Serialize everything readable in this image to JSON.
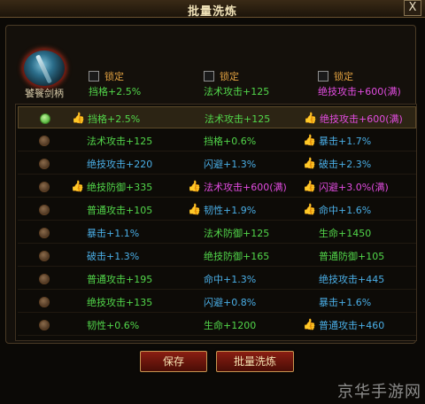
{
  "window": {
    "title": "批量洗炼",
    "close": "X"
  },
  "item": {
    "name": "饕餮剑柄",
    "icon": "sword-hilt-icon"
  },
  "lock_label": "锁定",
  "locks": [
    {
      "value": "挡格+2.5%",
      "color": "#52d64a"
    },
    {
      "value": "法术攻击+125",
      "color": "#52d64a"
    },
    {
      "value": "绝技攻击+600(满)",
      "color": "#e24ce0"
    }
  ],
  "rows": [
    {
      "selected": true,
      "cells": [
        {
          "text": "挡格+2.5%",
          "color": "green",
          "thumb": true
        },
        {
          "text": "法术攻击+125",
          "color": "green",
          "thumb": false
        },
        {
          "text": "绝技攻击+600(满)",
          "color": "purple",
          "thumb": true
        }
      ]
    },
    {
      "selected": false,
      "cells": [
        {
          "text": "法术攻击+125",
          "color": "green",
          "thumb": false
        },
        {
          "text": "挡格+0.6%",
          "color": "green",
          "thumb": false
        },
        {
          "text": "暴击+1.7%",
          "color": "blue",
          "thumb": true
        }
      ]
    },
    {
      "selected": false,
      "cells": [
        {
          "text": "绝技攻击+220",
          "color": "blue",
          "thumb": false
        },
        {
          "text": "闪避+1.3%",
          "color": "blue",
          "thumb": false
        },
        {
          "text": "破击+2.3%",
          "color": "blue",
          "thumb": true
        }
      ]
    },
    {
      "selected": false,
      "cells": [
        {
          "text": "绝技防御+335",
          "color": "green",
          "thumb": true
        },
        {
          "text": "法术攻击+600(满)",
          "color": "purple",
          "thumb": true
        },
        {
          "text": "闪避+3.0%(满)",
          "color": "purple",
          "thumb": true
        }
      ]
    },
    {
      "selected": false,
      "cells": [
        {
          "text": "普通攻击+105",
          "color": "green",
          "thumb": false
        },
        {
          "text": "韧性+1.9%",
          "color": "blue",
          "thumb": true
        },
        {
          "text": "命中+1.6%",
          "color": "blue",
          "thumb": true
        }
      ]
    },
    {
      "selected": false,
      "cells": [
        {
          "text": "暴击+1.1%",
          "color": "blue",
          "thumb": false
        },
        {
          "text": "法术防御+125",
          "color": "green",
          "thumb": false
        },
        {
          "text": "生命+1450",
          "color": "green",
          "thumb": false
        }
      ]
    },
    {
      "selected": false,
      "cells": [
        {
          "text": "破击+1.3%",
          "color": "blue",
          "thumb": false
        },
        {
          "text": "绝技防御+165",
          "color": "green",
          "thumb": false
        },
        {
          "text": "普通防御+105",
          "color": "green",
          "thumb": false
        }
      ]
    },
    {
      "selected": false,
      "cells": [
        {
          "text": "普通攻击+195",
          "color": "green",
          "thumb": false
        },
        {
          "text": "命中+1.3%",
          "color": "blue",
          "thumb": false
        },
        {
          "text": "绝技攻击+445",
          "color": "blue",
          "thumb": false
        }
      ]
    },
    {
      "selected": false,
      "cells": [
        {
          "text": "绝技攻击+135",
          "color": "green",
          "thumb": false
        },
        {
          "text": "闪避+0.8%",
          "color": "blue",
          "thumb": false
        },
        {
          "text": "暴击+1.6%",
          "color": "blue",
          "thumb": false
        }
      ]
    },
    {
      "selected": false,
      "cells": [
        {
          "text": "韧性+0.6%",
          "color": "green",
          "thumb": false
        },
        {
          "text": "生命+1200",
          "color": "green",
          "thumb": false
        },
        {
          "text": "普通攻击+460",
          "color": "blue",
          "thumb": true
        }
      ]
    }
  ],
  "buttons": {
    "save": "保存",
    "batch": "批量洗炼"
  },
  "watermark": "京华手游网",
  "colors": {
    "green": "#52d64a",
    "blue": "#4aaee6",
    "purple": "#e24ce0",
    "accent": "#c79650"
  }
}
